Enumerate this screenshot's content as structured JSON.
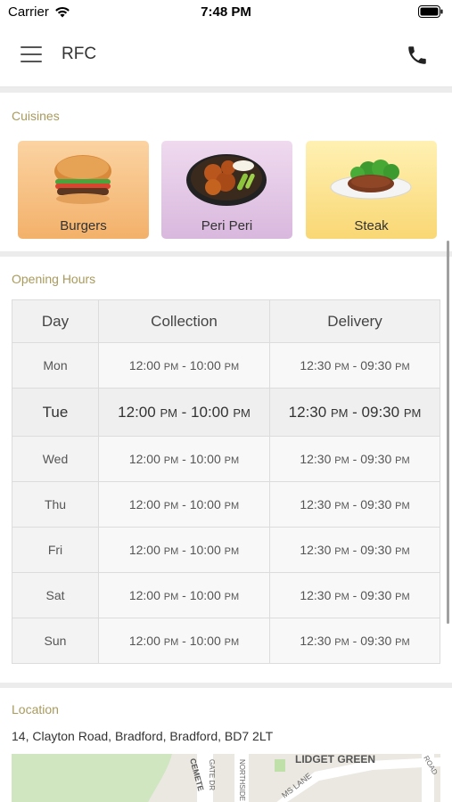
{
  "status": {
    "carrier": "Carrier",
    "time": "7:48 PM"
  },
  "nav": {
    "title": "RFC"
  },
  "cuisines": {
    "title": "Cuisines",
    "items": [
      {
        "label": "Burgers"
      },
      {
        "label": "Peri Peri"
      },
      {
        "label": "Steak"
      }
    ]
  },
  "hours": {
    "title": "Opening Hours",
    "headers": [
      "Day",
      "Collection",
      "Delivery"
    ],
    "rows": [
      {
        "day": "Mon",
        "col_start": "12:00",
        "col_end": "10:00",
        "del_start": "12:30",
        "del_end": "09:30"
      },
      {
        "day": "Tue",
        "col_start": "12:00",
        "col_end": "10:00",
        "del_start": "12:30",
        "del_end": "09:30"
      },
      {
        "day": "Wed",
        "col_start": "12:00",
        "col_end": "10:00",
        "del_start": "12:30",
        "del_end": "09:30"
      },
      {
        "day": "Thu",
        "col_start": "12:00",
        "col_end": "10:00",
        "del_start": "12:30",
        "del_end": "09:30"
      },
      {
        "day": "Fri",
        "col_start": "12:00",
        "col_end": "10:00",
        "del_start": "12:30",
        "del_end": "09:30"
      },
      {
        "day": "Sat",
        "col_start": "12:00",
        "col_end": "10:00",
        "del_start": "12:30",
        "del_end": "09:30"
      },
      {
        "day": "Sun",
        "col_start": "12:00",
        "col_end": "10:00",
        "del_start": "12:30",
        "del_end": "09:30"
      }
    ],
    "suffix": "PM",
    "separator": " - ",
    "highlighted_day": "Tue"
  },
  "location": {
    "title": "Location",
    "address": "14, Clayton Road, Bradford, Bradford, BD7 2LT",
    "map_labels": [
      "LIDGET GREEN",
      "GATE DR",
      "NORTHSIDE",
      "CEMETE",
      "MS LANE",
      "ROAD"
    ]
  },
  "colors": {
    "accent": "#a99a5c",
    "band": "#ececec"
  }
}
